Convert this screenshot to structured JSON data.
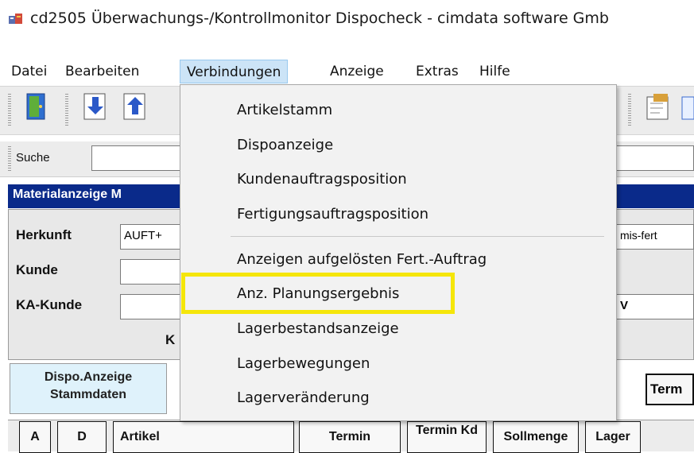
{
  "window": {
    "title": "cd2505 Überwachungs-/Kontrollmonitor Dispocheck - cimdata software Gmb"
  },
  "menubar": {
    "items": [
      "Datei",
      "Bearbeiten",
      "Verbindungen",
      "Anzeige",
      "Extras",
      "Hilfe"
    ],
    "active": "Verbindungen"
  },
  "toolbar": {
    "icons": [
      "door-exit-icon",
      "download-arrow-icon",
      "upload-arrow-icon",
      "edit-document-icon"
    ]
  },
  "search": {
    "label": "Suche",
    "value": ""
  },
  "panel": {
    "title": "Materialanzeige  M"
  },
  "form": {
    "herkunft_label": "Herkunft",
    "herkunft_value": "AUFT+",
    "kunde_label": "Kunde",
    "ka_kunde_label": "KA-Kunde",
    "k_label": "K",
    "right_value_1": "mis-fert",
    "right_value_2": "V"
  },
  "buttons": {
    "dispo_line1": "Dispo.Anzeige",
    "dispo_line2": "Stammdaten",
    "term": "Term"
  },
  "table": {
    "headers": [
      "A",
      "D",
      "Artikel",
      "Termin",
      "Termin Kd",
      "Sollmenge",
      "Lager"
    ]
  },
  "dropdown": {
    "items": [
      "Artikelstamm",
      "Dispoanzeige",
      "Kundenauftragsposition",
      "Fertigungsauftragsposition",
      "Anzeigen aufgelösten Fert.-Auftrag",
      "Anz. Planungsergebnis",
      "Lagerbestandsanzeige",
      "Lagerbewegungen",
      "Lagerveränderung"
    ],
    "highlighted": "Anz. Planungsergebnis",
    "highlight_color": "#f5e60a"
  }
}
